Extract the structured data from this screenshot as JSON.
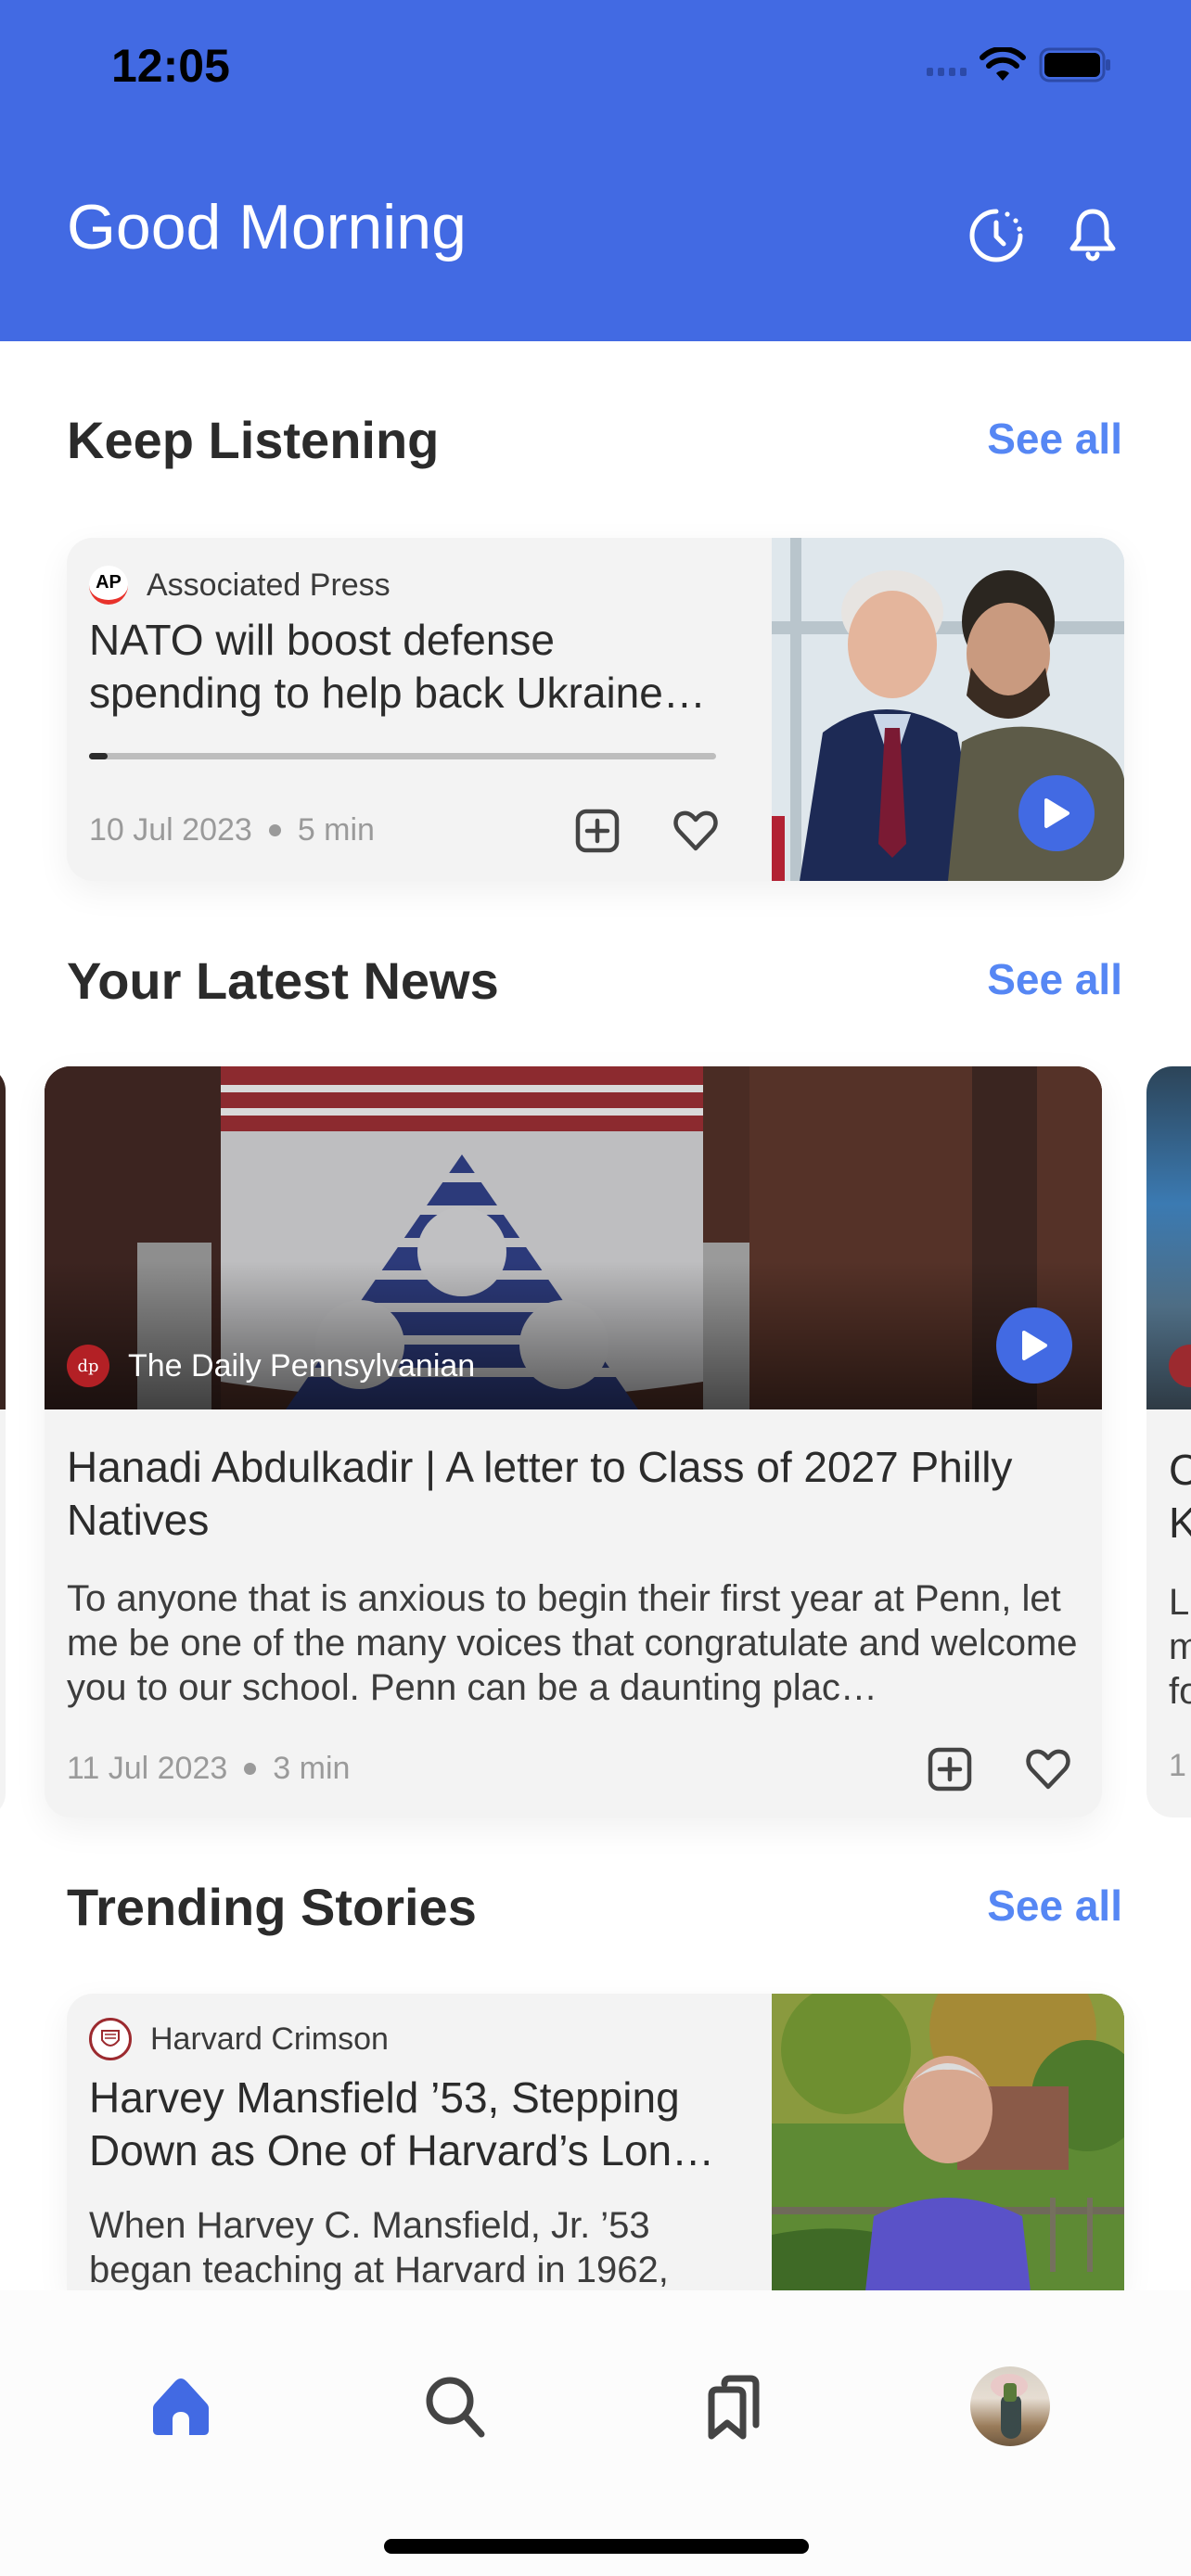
{
  "status_bar": {
    "time": "12:05"
  },
  "header": {
    "greeting": "Good Morning",
    "icons": [
      "history-icon",
      "bell-icon"
    ],
    "background_color": "#426ae3"
  },
  "sections": {
    "keep_listening": {
      "title": "Keep Listening",
      "see_all": "See all",
      "item": {
        "source": "Associated Press",
        "headline": "NATO will boost defense spending to help back Ukraine…",
        "progress_percent": 3,
        "date": "10 Jul 2023",
        "duration": "5 min"
      }
    },
    "latest_news": {
      "title": "Your Latest News",
      "see_all": "See all",
      "item": {
        "source": "The Daily Pennsylvanian",
        "headline": "Hanadi Abdulkadir | A letter to Class of 2027 Philly Natives",
        "summary": "To anyone that is anxious to begin their first year at Penn, let me be one of the many voices that congratulate and welcome you to our school. Penn can be a daunting plac…",
        "date": "11 Jul 2023",
        "duration": "3 min"
      },
      "next_item_peek": {
        "headline_lines": [
          "C",
          "K"
        ],
        "summary_lines": [
          "L",
          "m",
          "fo"
        ],
        "meta": "1"
      }
    },
    "trending": {
      "title": "Trending Stories",
      "see_all": "See all",
      "item": {
        "source": "Harvard Crimson",
        "headline": "Harvey Mansfield ’53, Stepping Down as One of Harvard’s Lon…",
        "summary": "When Harvey C. Mansfield, Jr. ’53 began teaching at Harvard in 1962,"
      }
    }
  },
  "bottom_nav": {
    "items": [
      {
        "name": "home",
        "icon": "home-icon",
        "active": true
      },
      {
        "name": "search",
        "icon": "search-icon",
        "active": false
      },
      {
        "name": "bookmarks",
        "icon": "bookmarks-icon",
        "active": false
      },
      {
        "name": "profile",
        "icon": "avatar",
        "active": false
      }
    ],
    "active_color": "#426ae3",
    "inactive_color": "#444444"
  },
  "colors": {
    "accent": "#426ae3",
    "link": "#5687f4",
    "card_bg": "#f3f3f3",
    "text": "#2b2b2b",
    "muted": "#9a9a9a"
  }
}
